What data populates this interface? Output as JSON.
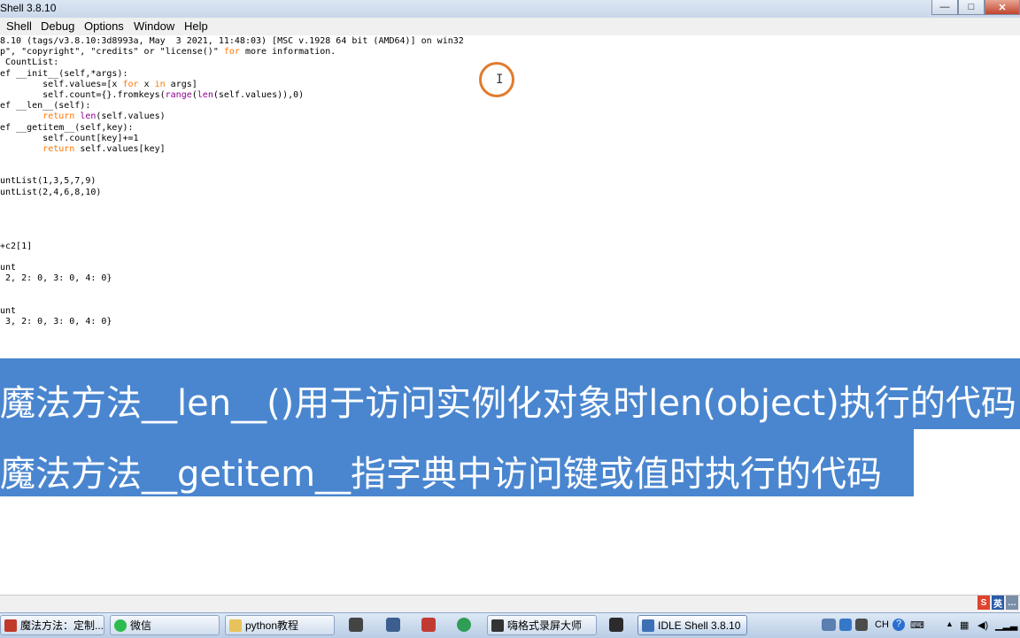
{
  "window": {
    "title": "Shell 3.8.10",
    "controls": {
      "minimize": "—",
      "maximize": "□",
      "close": "✕"
    }
  },
  "menu": [
    "Shell",
    "Debug",
    "Options",
    "Window",
    "Help"
  ],
  "shell_lines": [
    "8.10 (tags/v3.8.10:3d8993a, May  3 2021, 11:48:03) [MSC v.1928 64 bit (AMD64)] on win32",
    "p\", \"copyright\", \"credits\" or \"license()\" for more information.",
    " CountList:",
    "ef __init__(self,*args):",
    "        self.values=[x for x in args]",
    "        self.count={}.fromkeys(range(len(self.values)),0)",
    "ef __len__(self):",
    "        return len(self.values)",
    "ef __getitem__(self,key):",
    "        self.count[key]+=1",
    "        return self.values[key]",
    "",
    "",
    "untList(1,3,5,7,9)",
    "untList(2,4,6,8,10)",
    "",
    "",
    "",
    "",
    "+c2[1]",
    "",
    "unt",
    " 2, 2: 0, 3: 0, 4: 0}",
    "",
    "",
    "unt",
    " 3, 2: 0, 3: 0, 4: 0}"
  ],
  "captions": [
    "魔法方法__len__()用于访问实例化对象时len(object)执行的代码",
    "魔法方法__getitem__指字典中访问键或值时执行的代码"
  ],
  "ime": {
    "s": "S",
    "lang": "英"
  },
  "taskbar": {
    "buttons": [
      {
        "label": "魔法方法：定制...",
        "color": "#c0392b"
      },
      {
        "label": "微信",
        "color": "#2dbb4e"
      },
      {
        "label": "python教程",
        "color": "#e8c25a"
      },
      {
        "label": "嗨格式录屏大师",
        "color": "#333333"
      },
      {
        "label": "IDLE Shell 3.8.10",
        "color": "#3d6fb4"
      }
    ],
    "tray_lang": "CH",
    "tray_help": "?"
  }
}
